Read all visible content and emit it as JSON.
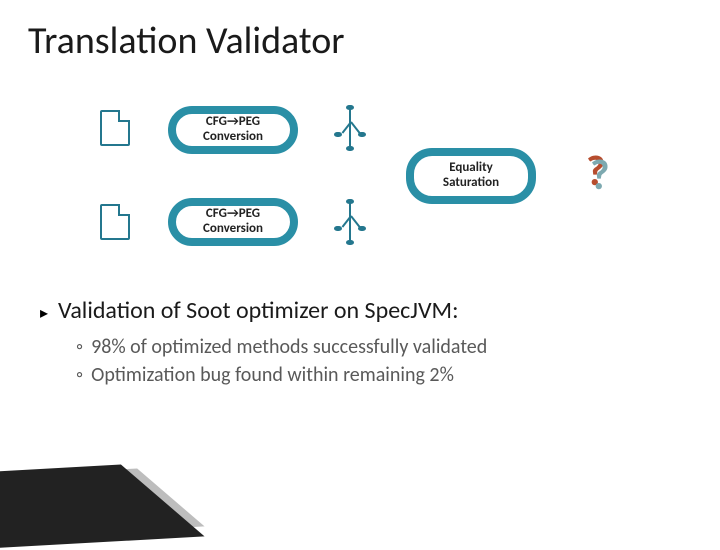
{
  "title": "Translation Validator",
  "diagram": {
    "conv_box_1": {
      "line1": "CFG→PEG",
      "line2": "Conversion"
    },
    "conv_box_2": {
      "line1": "CFG→PEG",
      "line2": "Conversion"
    },
    "eq_box": {
      "line1": "Equality",
      "line2": "Saturation"
    }
  },
  "bullet_main": "Validation of Soot optimizer on SpecJVM:",
  "bullet_sub_1": "98% of optimized methods successfully validated",
  "bullet_sub_2": "Optimization bug found within remaining 2%"
}
